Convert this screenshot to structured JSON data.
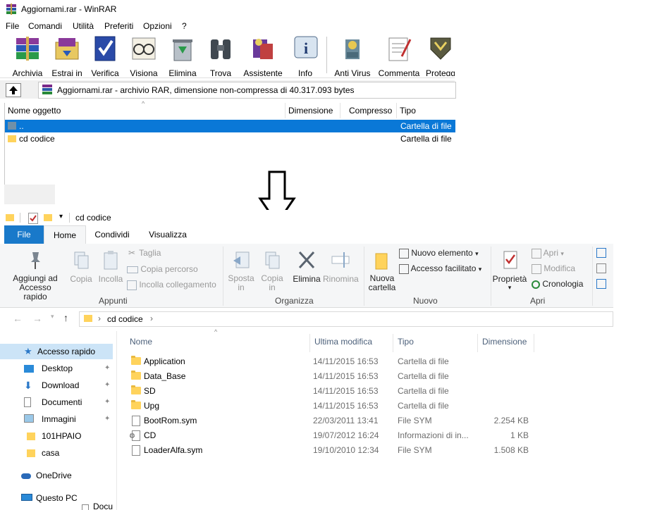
{
  "winrar": {
    "title": "Aggiornami.rar - WinRAR",
    "menu": [
      "File",
      "Comandi",
      "Utilità",
      "Preferiti",
      "Opzioni",
      "?"
    ],
    "toolbar": [
      "Archivia",
      "Estrai in",
      "Verifica",
      "Visiona",
      "Elimina",
      "Trova",
      "Assistente",
      "Info",
      "Anti Virus",
      "Commenta",
      "Protegg"
    ],
    "address": "Aggiornami.rar - archivio RAR, dimensione non-compressa di 40.317.093 bytes",
    "columns": [
      "Nome oggetto",
      "Dimensione",
      "Compresso",
      "Tipo"
    ],
    "rows": [
      {
        "name": "..",
        "type": "Cartella di file"
      },
      {
        "name": "cd codice",
        "type": "Cartella di file"
      }
    ]
  },
  "explorer": {
    "window_title": "cd codice",
    "tabs": [
      "File",
      "Home",
      "Condividi",
      "Visualizza"
    ],
    "ribbon": {
      "appunti": {
        "pin": "Aggiungi ad Accesso rapido",
        "copia": "Copia",
        "incolla": "Incolla",
        "taglia": "Taglia",
        "copia_percorso": "Copia percorso",
        "incolla_collegamento": "Incolla collegamento",
        "label": "Appunti"
      },
      "organizza": {
        "sposta": "Sposta in",
        "copia_in": "Copia in",
        "elimina": "Elimina",
        "rinomina": "Rinomina",
        "label": "Organizza"
      },
      "nuovo": {
        "nuova_cartella": "Nuova cartella",
        "nuovo_elemento": "Nuovo elemento",
        "accesso_facilitato": "Accesso facilitato",
        "label": "Nuovo"
      },
      "apri": {
        "proprieta": "Proprietà",
        "apri": "Apri",
        "modifica": "Modifica",
        "cronologia": "Cronologia",
        "label": "Apri"
      }
    },
    "breadcrumb": "cd codice",
    "sidebar": [
      {
        "label": "Accesso rapido",
        "icon": "star-icon"
      },
      {
        "label": "Desktop",
        "icon": "desktop-icon",
        "pinned": true
      },
      {
        "label": "Download",
        "icon": "download-icon",
        "pinned": true
      },
      {
        "label": "Documenti",
        "icon": "document-icon",
        "pinned": true
      },
      {
        "label": "Immagini",
        "icon": "pictures-icon",
        "pinned": true
      },
      {
        "label": "101HPAIO",
        "icon": "folder-icon"
      },
      {
        "label": "casa",
        "icon": "folder-icon"
      },
      {
        "label": "OneDrive",
        "icon": "cloud-icon"
      },
      {
        "label": "Questo PC",
        "icon": "computer-icon"
      },
      {
        "label": "Documenti",
        "icon": "document-icon"
      }
    ],
    "columns": [
      "Nome",
      "Ultima modifica",
      "Tipo",
      "Dimensione"
    ],
    "files": [
      {
        "name": "Application",
        "date": "14/11/2015 16:53",
        "type": "Cartella di file",
        "size": "",
        "kind": "folder"
      },
      {
        "name": "Data_Base",
        "date": "14/11/2015 16:53",
        "type": "Cartella di file",
        "size": "",
        "kind": "folder"
      },
      {
        "name": "SD",
        "date": "14/11/2015 16:53",
        "type": "Cartella di file",
        "size": "",
        "kind": "folder"
      },
      {
        "name": "Upg",
        "date": "14/11/2015 16:53",
        "type": "Cartella di file",
        "size": "",
        "kind": "folder"
      },
      {
        "name": "BootRom.sym",
        "date": "22/03/2011 13:41",
        "type": "File SYM",
        "size": "2.254 KB",
        "kind": "file"
      },
      {
        "name": "CD",
        "date": "19/07/2012 16:24",
        "type": "Informazioni di in...",
        "size": "1 KB",
        "kind": "settings"
      },
      {
        "name": "LoaderAlfa.sym",
        "date": "19/10/2010 12:34",
        "type": "File SYM",
        "size": "1.508 KB",
        "kind": "file"
      }
    ]
  }
}
